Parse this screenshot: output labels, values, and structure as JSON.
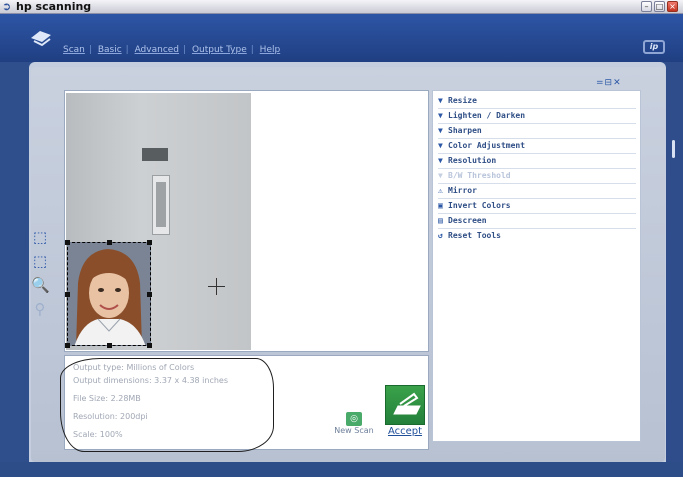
{
  "window": {
    "title": "hp scanning"
  },
  "menu": {
    "items": [
      "Scan",
      "Basic",
      "Advanced",
      "Output Type",
      "Help"
    ]
  },
  "tools": {
    "items": [
      {
        "label": "Resize",
        "icon": "triangle-down-icon",
        "enabled": true
      },
      {
        "label": "Lighten / Darken",
        "icon": "triangle-down-icon",
        "enabled": true
      },
      {
        "label": "Sharpen",
        "icon": "triangle-down-icon",
        "enabled": true
      },
      {
        "label": "Color Adjustment",
        "icon": "triangle-down-icon",
        "enabled": true
      },
      {
        "label": "Resolution",
        "icon": "triangle-down-icon",
        "enabled": true
      },
      {
        "label": "B/W Threshold",
        "icon": "triangle-down-icon",
        "enabled": false
      },
      {
        "label": "Mirror",
        "icon": "mirror-icon",
        "enabled": true
      },
      {
        "label": "Invert Colors",
        "icon": "invert-colors-icon",
        "enabled": true
      },
      {
        "label": "Descreen",
        "icon": "descreen-icon",
        "enabled": true
      },
      {
        "label": "Reset Tools",
        "icon": "reset-icon",
        "enabled": true
      }
    ]
  },
  "info": {
    "output_type": "Output type: Millions of Colors",
    "output_dimensions": "Output dimensions: 3.37 x 4.38 inches",
    "file_size": "File Size: 2.28MB",
    "resolution": "Resolution:  200dpi",
    "scale": "Scale: 100%"
  },
  "actions": {
    "new_scan": "New Scan",
    "accept": "Accept"
  },
  "colors": {
    "header": "#2d55a5",
    "accent": "#2c58a6",
    "accept": "#2f9a45"
  }
}
